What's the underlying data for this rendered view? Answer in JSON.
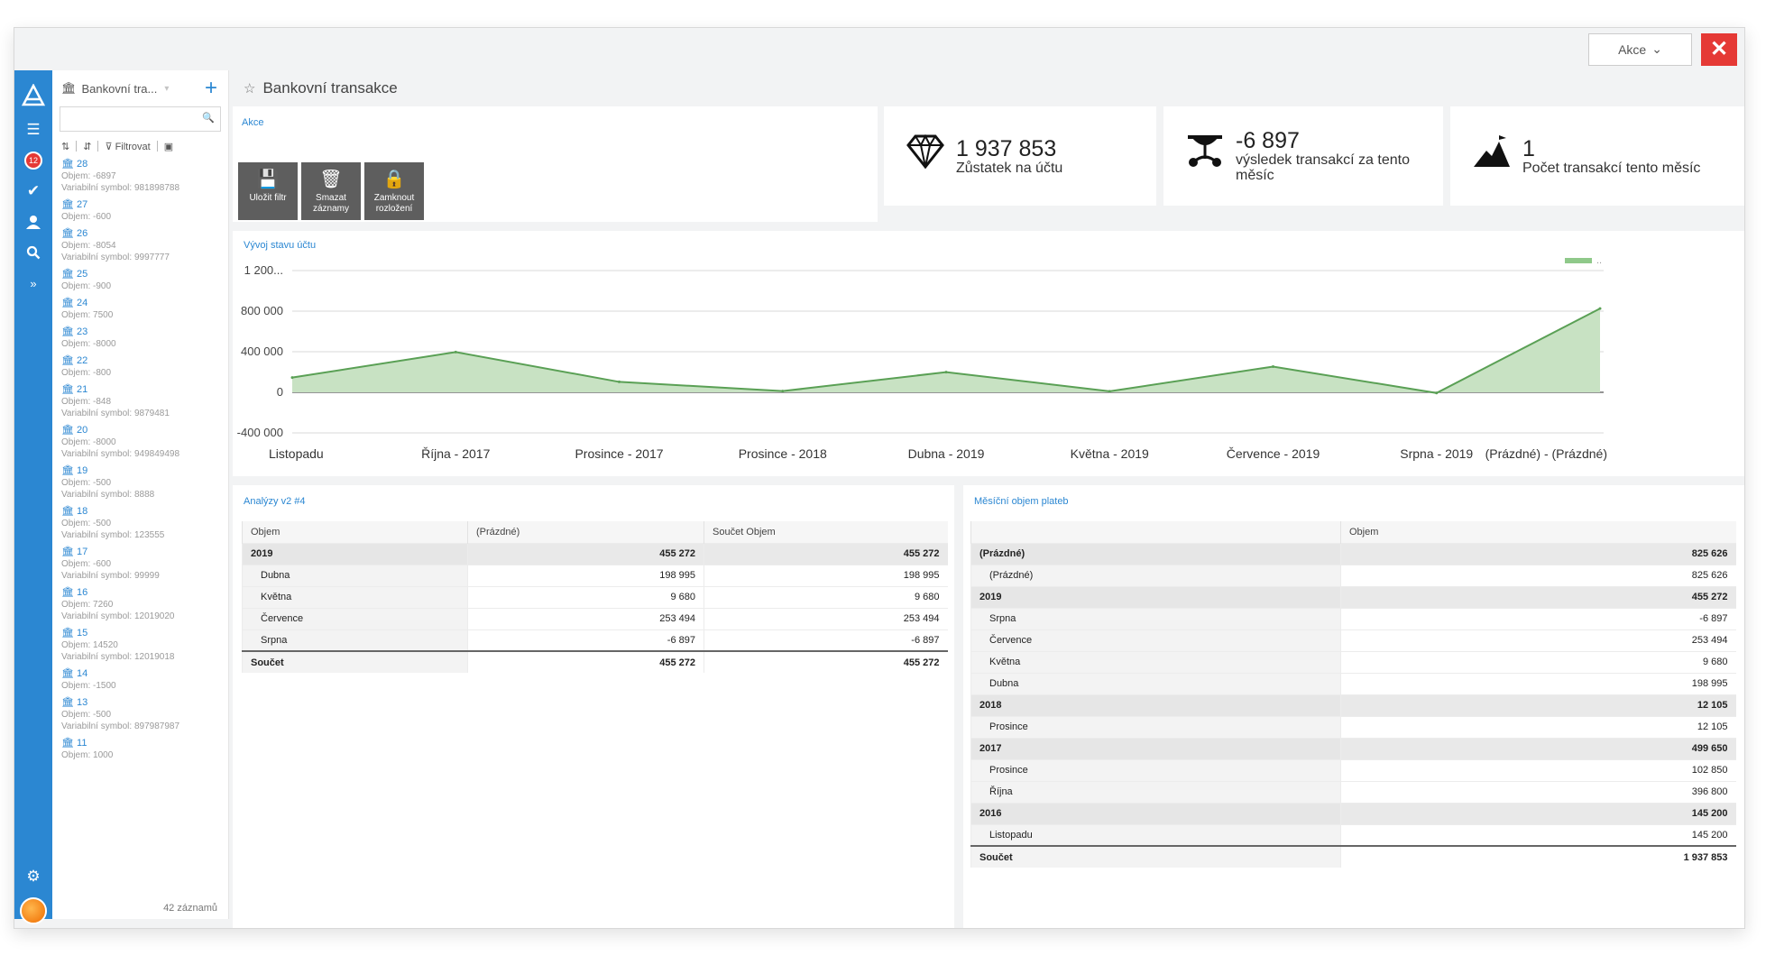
{
  "header": {
    "title": "Bankovní transakce",
    "akce_label": "Akce",
    "close_symbol": "✕"
  },
  "sidebar": {
    "badge": "12",
    "icons": [
      "app-logo-icon",
      "menu-icon",
      "notifications-icon",
      "check-icon",
      "users-icon",
      "search-icon",
      "expand-icon",
      "gear-icon",
      "avatar"
    ]
  },
  "list": {
    "title": "Bankovní tra...",
    "search_placeholder": "",
    "filter_label": "Filtrovat",
    "count_label": "42 záznamů",
    "records": [
      {
        "id": "28",
        "lines": [
          "Objem: -6897",
          "Variabilní symbol: 981898788"
        ]
      },
      {
        "id": "27",
        "lines": [
          "Objem: -600"
        ]
      },
      {
        "id": "26",
        "lines": [
          "Objem: -8054",
          "Variabilní symbol: 9997777"
        ]
      },
      {
        "id": "25",
        "lines": [
          "Objem: -900"
        ]
      },
      {
        "id": "24",
        "lines": [
          "Objem: 7500"
        ]
      },
      {
        "id": "23",
        "lines": [
          "Objem: -8000"
        ]
      },
      {
        "id": "22",
        "lines": [
          "Objem: -800"
        ]
      },
      {
        "id": "21",
        "lines": [
          "Objem: -848",
          "Variabilní symbol: 9879481"
        ]
      },
      {
        "id": "20",
        "lines": [
          "Objem: -8000",
          "Variabilní symbol: 949849498"
        ]
      },
      {
        "id": "19",
        "lines": [
          "Objem: -500",
          "Variabilní symbol: 8888"
        ]
      },
      {
        "id": "18",
        "lines": [
          "Objem: -500",
          "Variabilní symbol: 123555"
        ]
      },
      {
        "id": "17",
        "lines": [
          "Objem: -600",
          "Variabilní symbol: 99999"
        ]
      },
      {
        "id": "16",
        "lines": [
          "Objem: 7260",
          "Variabilní symbol: 12019020"
        ]
      },
      {
        "id": "15",
        "lines": [
          "Objem: 14520",
          "Variabilní symbol: 12019018"
        ]
      },
      {
        "id": "14",
        "lines": [
          "Objem: -1500"
        ]
      },
      {
        "id": "13",
        "lines": [
          "Objem: -500",
          "Variabilní symbol: 897987987"
        ]
      },
      {
        "id": "11",
        "lines": [
          "Objem: 1000"
        ]
      }
    ]
  },
  "actions": {
    "label": "Akce",
    "buttons": [
      {
        "label": "Uložit filtr",
        "icon": "save-icon"
      },
      {
        "label": "Smazat záznamy",
        "icon": "trash-icon"
      },
      {
        "label": "Zamknout rozložení",
        "icon": "lock-icon"
      }
    ]
  },
  "stats": [
    {
      "value": "1 937 853",
      "label": "Zůstatek na účtu",
      "icon": "diamond-icon"
    },
    {
      "value": "-6 897",
      "label": "výsledek transakcí za tento měsíc",
      "icon": "balance-icon"
    },
    {
      "value": "1",
      "label": "Počet transakcí tento měsíc",
      "icon": "mountain-icon"
    }
  ],
  "chart_data": {
    "type": "area",
    "title": "Vývoj stavu účtu",
    "categories": [
      "Listopadu",
      "Října - 2017",
      "Prosince - 2017",
      "Prosince - 2018",
      "Dubna - 2019",
      "Května - 2019",
      "Července - 2019",
      "Srpna - 2019",
      "(Prázdné) - (Prázdné)"
    ],
    "y_tick_labels": [
      "1 200...",
      "800 000",
      "400 000",
      "0",
      "-400 000"
    ],
    "ylim": [
      -400000,
      1200000
    ],
    "legend_label": "..",
    "legend_position": "top-right",
    "series": [
      {
        "values": [
          145200,
          396800,
          102850,
          12105,
          198995,
          9680,
          253494,
          -6897,
          825626
        ],
        "color": "#5aa055"
      }
    ]
  },
  "analysis": {
    "label": "Analýzy v2 #4",
    "headers": [
      "Objem",
      "(Prázdné)",
      "Součet Objem"
    ],
    "rows": [
      {
        "kind": "grp",
        "label": "2019",
        "v1": "455 272",
        "v2": "455 272"
      },
      {
        "kind": "sub",
        "label": "Dubna",
        "v1": "198 995",
        "v2": "198 995"
      },
      {
        "kind": "sub",
        "label": "Května",
        "v1": "9 680",
        "v2": "9 680"
      },
      {
        "kind": "sub",
        "label": "Července",
        "v1": "253 494",
        "v2": "253 494"
      },
      {
        "kind": "sub",
        "label": "Srpna",
        "v1": "-6 897",
        "v2": "-6 897"
      },
      {
        "kind": "tot",
        "label": "Součet",
        "v1": "455 272",
        "v2": "455 272"
      }
    ]
  },
  "monthly": {
    "label": "Měsíční objem plateb",
    "headers": [
      "",
      "Objem"
    ],
    "rows": [
      {
        "kind": "grp",
        "label": "(Prázdné)",
        "v": "825 626"
      },
      {
        "kind": "sub",
        "label": "(Prázdné)",
        "v": "825 626"
      },
      {
        "kind": "grp",
        "label": "2019",
        "v": "455 272"
      },
      {
        "kind": "sub",
        "label": "Srpna",
        "v": "-6 897"
      },
      {
        "kind": "sub",
        "label": "Července",
        "v": "253 494"
      },
      {
        "kind": "sub",
        "label": "Května",
        "v": "9 680"
      },
      {
        "kind": "sub",
        "label": "Dubna",
        "v": "198 995"
      },
      {
        "kind": "grp",
        "label": "2018",
        "v": "12 105"
      },
      {
        "kind": "sub",
        "label": "Prosince",
        "v": "12 105"
      },
      {
        "kind": "grp",
        "label": "2017",
        "v": "499 650"
      },
      {
        "kind": "sub",
        "label": "Prosince",
        "v": "102 850"
      },
      {
        "kind": "sub",
        "label": "Října",
        "v": "396 800"
      },
      {
        "kind": "grp",
        "label": "2016",
        "v": "145 200"
      },
      {
        "kind": "sub",
        "label": "Listopadu",
        "v": "145 200"
      },
      {
        "kind": "tot",
        "label": "Součet",
        "v": "1 937 853"
      }
    ]
  }
}
